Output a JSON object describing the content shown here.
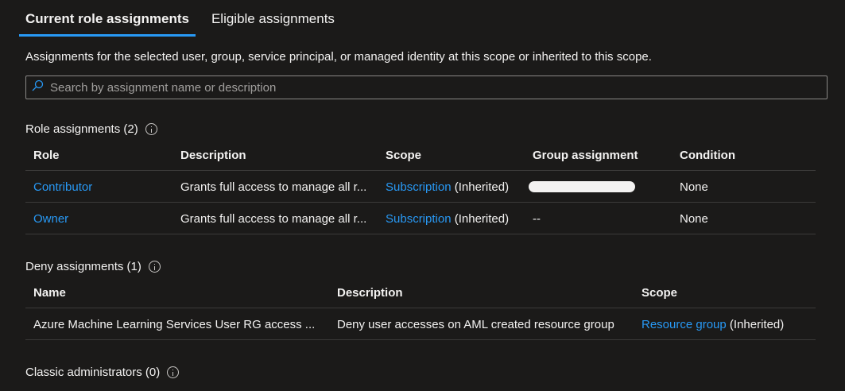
{
  "tabs": {
    "current": "Current role assignments",
    "eligible": "Eligible assignments"
  },
  "description": "Assignments for the selected user, group, service principal, or managed identity at this scope or inherited to this scope.",
  "search": {
    "placeholder": "Search by assignment name or description",
    "value": ""
  },
  "role_assignments": {
    "title": "Role assignments (2)",
    "columns": {
      "role": "Role",
      "description": "Description",
      "scope": "Scope",
      "group": "Group assignment",
      "condition": "Condition"
    },
    "rows": [
      {
        "role": "Contributor",
        "description": "Grants full access to manage all r...",
        "scope_link": "Subscription",
        "scope_suffix": "(Inherited)",
        "group": "",
        "condition": "None"
      },
      {
        "role": "Owner",
        "description": "Grants full access to manage all r...",
        "scope_link": "Subscription",
        "scope_suffix": "(Inherited)",
        "group": "--",
        "condition": "None"
      }
    ]
  },
  "deny_assignments": {
    "title": "Deny assignments (1)",
    "columns": {
      "name": "Name",
      "description": "Description",
      "scope": "Scope"
    },
    "rows": [
      {
        "name": "Azure Machine Learning Services User RG access ...",
        "description": "Deny user accesses on AML created resource group",
        "scope_link": "Resource group",
        "scope_suffix": "(Inherited)"
      }
    ]
  },
  "classic_admins": {
    "title": "Classic administrators (0)"
  },
  "colors": {
    "accent": "#2899f5",
    "background": "#1b1a19"
  }
}
